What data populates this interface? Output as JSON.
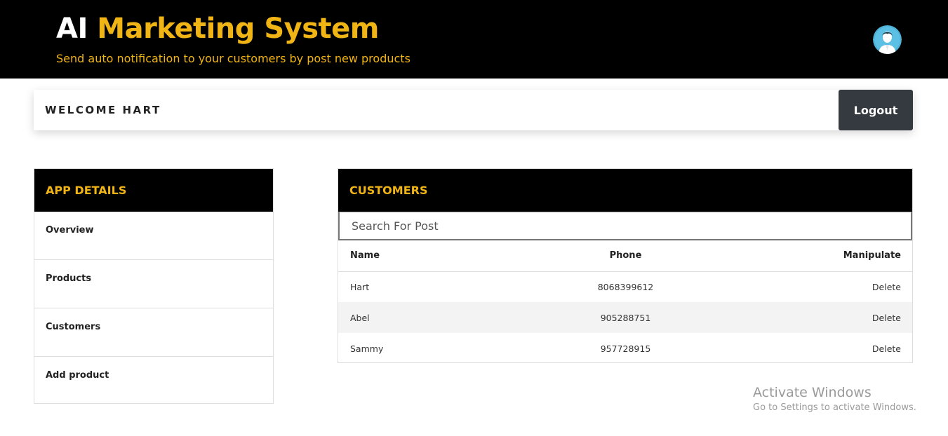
{
  "header": {
    "title_part1": "AI",
    "title_part2": "Marketing System",
    "subtitle": "Send auto notification to your customers by post new products",
    "avatar_icon": "user-avatar-icon"
  },
  "welcome": {
    "text": "WELCOME HART",
    "logout_label": "Logout"
  },
  "sidebar": {
    "title": "APP DETAILS",
    "items": [
      {
        "label": "Overview"
      },
      {
        "label": "Products"
      },
      {
        "label": "Customers"
      },
      {
        "label": "Add product"
      }
    ]
  },
  "customers": {
    "title": "CUSTOMERS",
    "search_placeholder": "Search For Post",
    "columns": [
      "Name",
      "Phone",
      "Manipulate"
    ],
    "rows": [
      {
        "name": "Hart",
        "phone": "8068399612",
        "action": "Delete"
      },
      {
        "name": "Abel",
        "phone": "905288751",
        "action": "Delete"
      },
      {
        "name": "Sammy",
        "phone": "957728915",
        "action": "Delete"
      }
    ]
  },
  "watermark": {
    "line1": "Activate Windows",
    "line2": "Go to Settings to activate Windows."
  },
  "colors": {
    "accent": "#f0b414",
    "header_bg": "#000000",
    "button_bg": "#343a40"
  }
}
